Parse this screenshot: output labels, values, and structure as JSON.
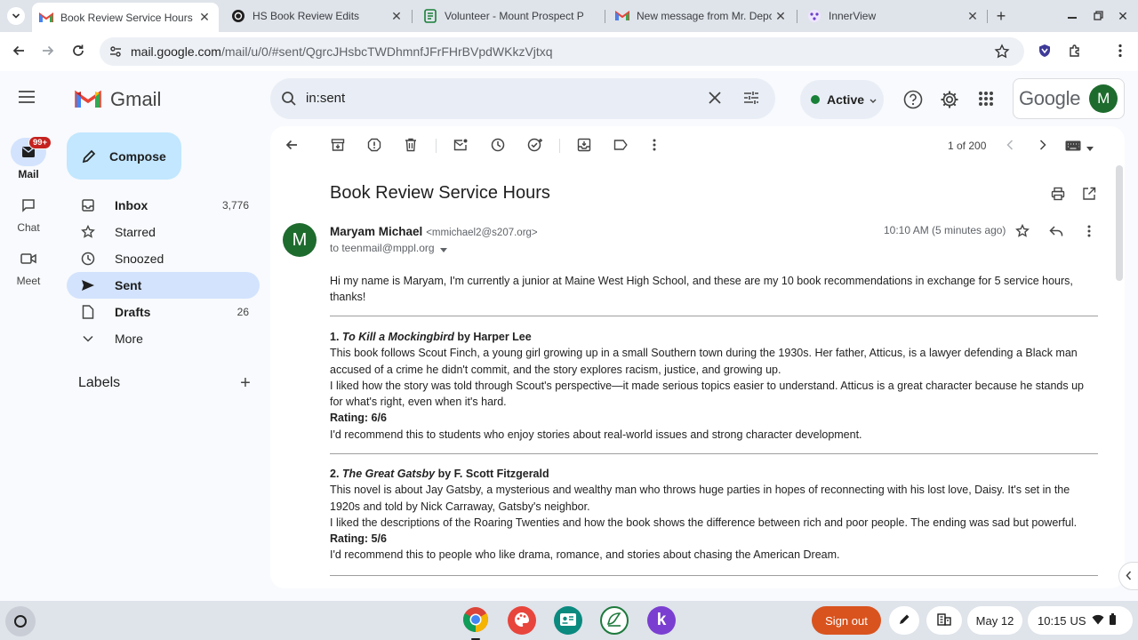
{
  "browser": {
    "tabs": [
      {
        "title": "Book Review Service Hours - m",
        "icon": "gmail-icon",
        "active": true
      },
      {
        "title": "HS Book Review Edits",
        "icon": "openai-icon",
        "active": false
      },
      {
        "title": "Volunteer - Mount Prospect P",
        "icon": "form-icon",
        "active": false
      },
      {
        "title": "New message from Mr. Depc",
        "icon": "gmail-icon",
        "active": false
      },
      {
        "title": "InnerView",
        "icon": "innerview-icon",
        "active": false
      }
    ],
    "url_host": "mail.google.com",
    "url_path": "/mail/u/0/#sent/QgrcJHsbcTWDhmnfJFrFHrBVpdWKkzVjtxq"
  },
  "gmail": {
    "logo_text": "Gmail",
    "compose_label": "Compose",
    "rail": [
      {
        "label": "Mail",
        "badge": "99+",
        "icon": "mail-icon"
      },
      {
        "label": "Chat",
        "icon": "chat-icon"
      },
      {
        "label": "Meet",
        "icon": "meet-icon"
      }
    ],
    "nav": [
      {
        "label": "Inbox",
        "count": "3,776",
        "icon": "inbox-icon"
      },
      {
        "label": "Starred",
        "count": "",
        "icon": "star-icon"
      },
      {
        "label": "Snoozed",
        "count": "",
        "icon": "clock-icon"
      },
      {
        "label": "Sent",
        "count": "",
        "icon": "send-icon"
      },
      {
        "label": "Drafts",
        "count": "26",
        "icon": "draft-icon"
      },
      {
        "label": "More",
        "count": "",
        "icon": "chevron-down-icon"
      }
    ],
    "labels_heading": "Labels",
    "search_value": "in:sent",
    "status_label": "Active",
    "google_text": "Google",
    "avatar_letter": "M",
    "pager": "1 of 200"
  },
  "email": {
    "subject": "Book Review Service Hours",
    "sender_name": "Maryam Michael",
    "sender_email": "<mmichael2@s207.org>",
    "to_line": "to teenmail@mppl.org",
    "time": "10:10 AM (5 minutes ago)",
    "avatar_letter": "M",
    "intro": "Hi my name is Maryam, I'm currently a junior at Maine West High School, and these are my 10 book recommendations in exchange for 5 service hours, thanks!",
    "books": [
      {
        "num": "1.",
        "title": "To Kill a Mockingbird",
        "by": "by Harper Lee",
        "summary": "This book follows Scout Finch, a young girl growing up in a small Southern town during the 1930s. Her father, Atticus, is a lawyer defending a Black man accused of a crime he didn't commit, and the story explores racism, justice, and growing up.",
        "opinion": "I liked how the story was told through Scout's perspective—it made serious topics easier to understand. Atticus is a great character because he stands up for what's right, even when it's hard.",
        "rating": "Rating: 6/6",
        "recommend": "I'd recommend this to students who enjoy stories about real-world issues and strong character development."
      },
      {
        "num": "2.",
        "title": "The Great Gatsby",
        "by": "by F. Scott Fitzgerald",
        "summary": "This novel is about Jay Gatsby, a mysterious and wealthy man who throws huge parties in hopes of reconnecting with his lost love, Daisy. It's set in the 1920s and told by Nick Carraway, Gatsby's neighbor.",
        "opinion": "I liked the descriptions of the Roaring Twenties and how the book shows the difference between rich and poor people. The ending was sad but powerful.",
        "rating": "Rating: 5/6",
        "recommend": "I'd recommend this to people who like drama, romance, and stories about chasing the American Dream."
      }
    ]
  },
  "shelf": {
    "signout_label": "Sign out",
    "date": "May 12",
    "time": "10:15",
    "locale": "US"
  },
  "colors": {
    "accent_blue": "#0b57d0",
    "nav_selected": "#d3e3fd",
    "compose_bg": "#c2e7ff",
    "avatar_green": "#1e6b2e",
    "active_green": "#188038",
    "signout_orange": "#d9531e"
  }
}
